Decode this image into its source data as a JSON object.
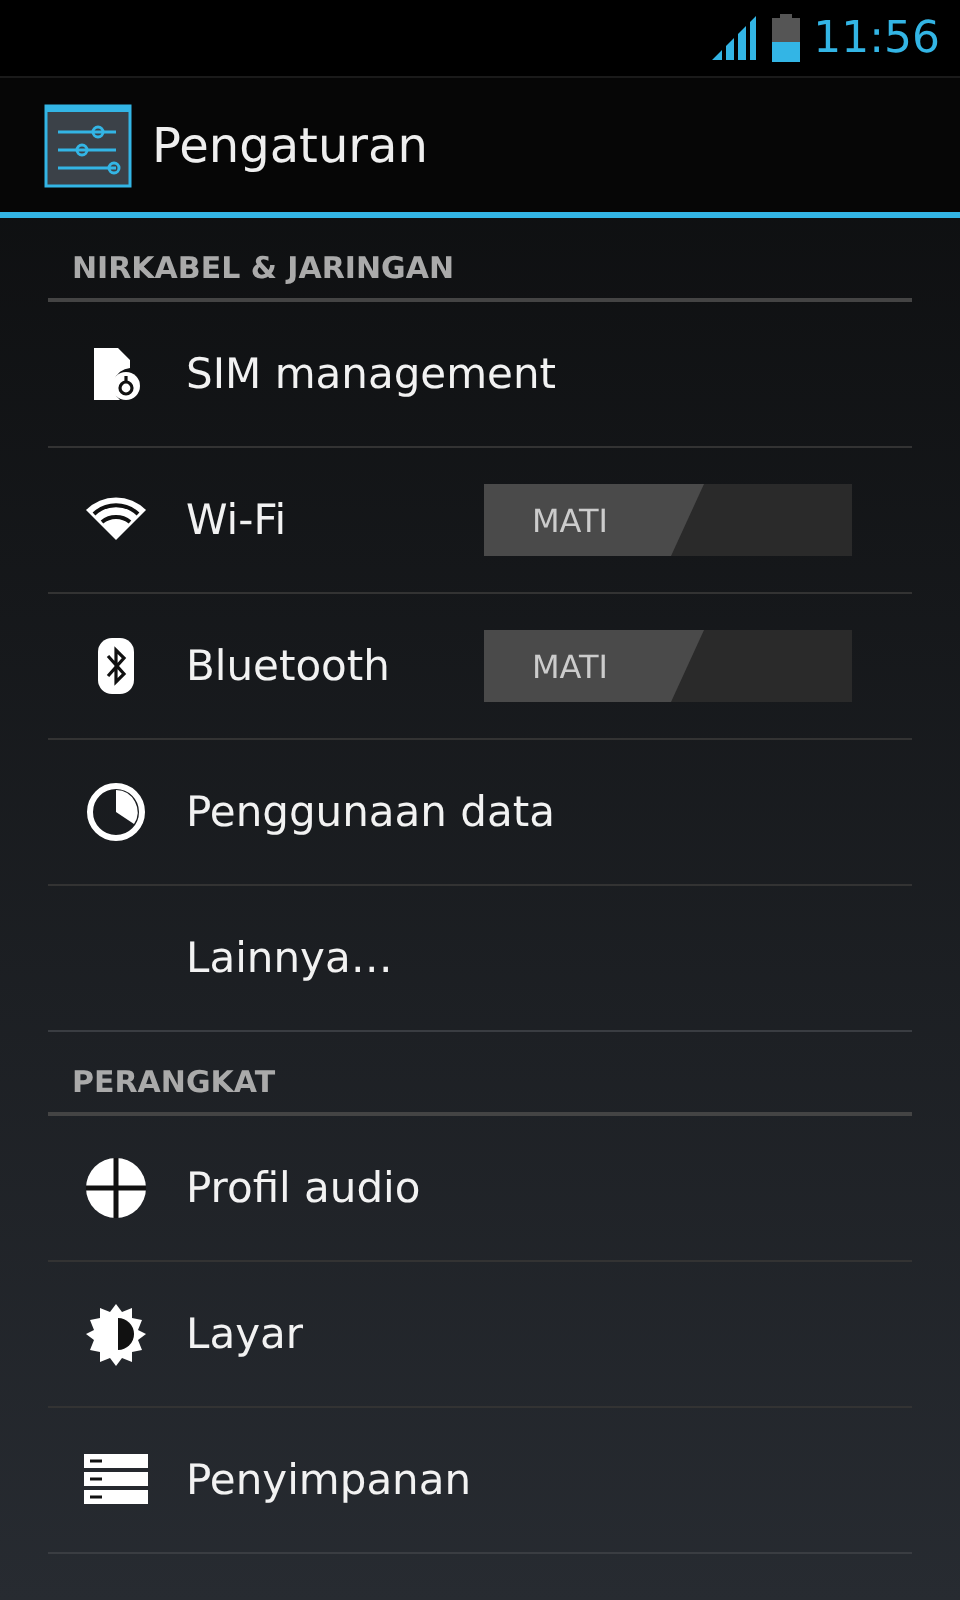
{
  "status_bar": {
    "time": "11:56"
  },
  "action_bar": {
    "title": "Pengaturan"
  },
  "sections": [
    {
      "header": "NIRKABEL & JARINGAN",
      "items": [
        {
          "kind": "plain",
          "label": "SIM management"
        },
        {
          "kind": "toggle",
          "label": "Wi-Fi",
          "toggle": {
            "on": false,
            "label": "MATI"
          }
        },
        {
          "kind": "toggle",
          "label": "Bluetooth",
          "toggle": {
            "on": false,
            "label": "MATI"
          }
        },
        {
          "kind": "plain",
          "label": "Penggunaan data"
        },
        {
          "kind": "plain",
          "label": "Lainnya…"
        }
      ]
    },
    {
      "header": "PERANGKAT",
      "items": [
        {
          "kind": "plain",
          "label": "Profil audio"
        },
        {
          "kind": "plain",
          "label": "Layar"
        },
        {
          "kind": "plain",
          "label": "Penyimpanan"
        }
      ]
    }
  ]
}
